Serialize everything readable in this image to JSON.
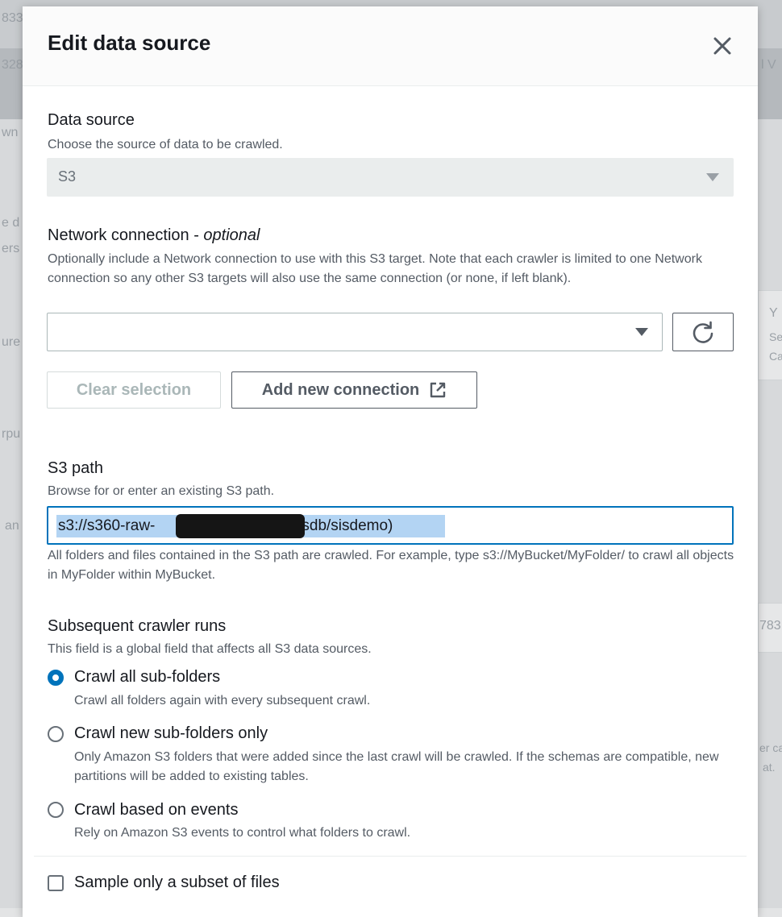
{
  "modal": {
    "title": "Edit data source"
  },
  "data_source": {
    "label": "Data source",
    "description": "Choose the source of data to be crawled.",
    "value": "S3"
  },
  "network_connection": {
    "label": "Network connection - ",
    "label_optional": "optional",
    "description": "Optionally include a Network connection to use with this S3 target. Note that each crawler is limited to one Network connection so any other S3 targets will also use the same connection (or none, if left blank).",
    "value": "",
    "clear_button": "Clear selection",
    "add_button": "Add new connection"
  },
  "s3_path": {
    "label": "S3 path",
    "description": "Browse for or enter an existing S3 path.",
    "value_prefix": "s3://s360-raw-",
    "value_suffix": "/sisdb/sisdemo)",
    "help": "All folders and files contained in the S3 path are crawled. For example, type s3://MyBucket/MyFolder/ to crawl all objects in MyFolder within MyBucket."
  },
  "subsequent_runs": {
    "label": "Subsequent crawler runs",
    "description": "This field is a global field that affects all S3 data sources.",
    "options": [
      {
        "label": "Crawl all sub-folders",
        "description": "Crawl all folders again with every subsequent crawl.",
        "selected": true
      },
      {
        "label": "Crawl new sub-folders only",
        "description": "Only Amazon S3 folders that were added since the last crawl will be crawled. If the schemas are compatible, new partitions will be added to existing tables.",
        "selected": false
      },
      {
        "label": "Crawl based on events",
        "description": "Rely on Amazon S3 events to control what folders to crawl.",
        "selected": false
      }
    ]
  },
  "sample": {
    "label": "Sample only a subset of files",
    "checked": false
  },
  "background": {
    "fragments": [
      "833",
      "328",
      "wn",
      "e d",
      "ers",
      "ure",
      "rpu",
      "an",
      "Y",
      "Se",
      "Ca",
      "783",
      "er ca",
      "at.",
      "l V"
    ]
  },
  "colors": {
    "accent": "#0073bb",
    "text": "#16191f",
    "muted": "#545b64"
  },
  "icons": [
    "close-icon",
    "dropdown-arrow-icon",
    "refresh-icon",
    "external-link-icon"
  ]
}
